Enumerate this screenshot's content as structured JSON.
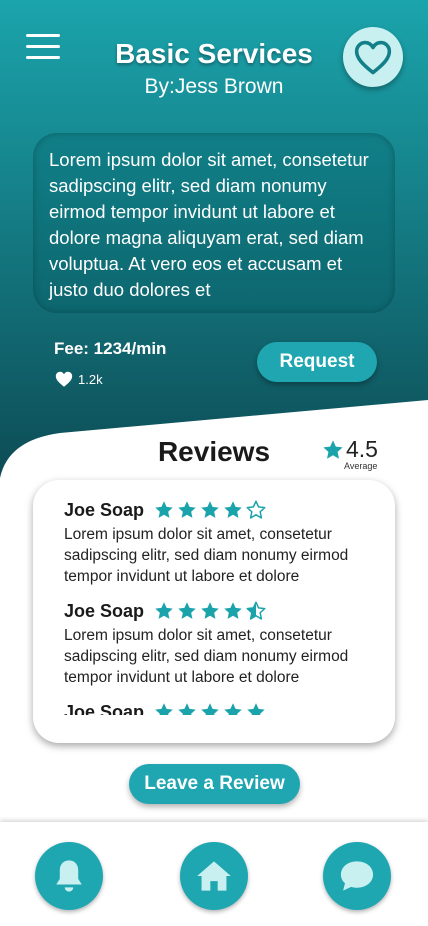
{
  "header": {
    "title": "Basic Services",
    "subtitle": "By:Jess Brown"
  },
  "service": {
    "description": "Lorem ipsum dolor sit amet, consetetur sadipscing elitr, sed diam nonumy eirmod tempor invidunt ut labore et dolore magna aliquyam erat, sed diam voluptua. At vero eos et accusam et justo duo dolores et",
    "fee": "Fee: 1234/min",
    "likes": "1.2k",
    "request_label": "Request"
  },
  "reviews": {
    "heading": "Reviews",
    "average": "4.5",
    "average_label": "Average",
    "items": [
      {
        "name": "Joe Soap",
        "rating": 4,
        "text": "Lorem ipsum dolor sit amet, consetetur sadipscing elitr, sed diam nonumy eirmod tempor invidunt ut labore et dolore"
      },
      {
        "name": "Joe Soap",
        "rating": 4.5,
        "text": "Lorem ipsum dolor sit amet, consetetur sadipscing elitr, sed diam nonumy eirmod tempor invidunt ut labore et dolore"
      },
      {
        "name": "Joe Soap",
        "rating": 5,
        "text": ""
      }
    ],
    "leave_label": "Leave a Review"
  },
  "nav": {
    "items": [
      {
        "icon": "bell-icon"
      },
      {
        "icon": "home-icon"
      },
      {
        "icon": "chat-icon"
      }
    ]
  },
  "colors": {
    "accent": "#1fa6b0",
    "header_top": "#1aa3ab",
    "header_bottom": "#0e4f57",
    "star": "#1aa3ab"
  }
}
